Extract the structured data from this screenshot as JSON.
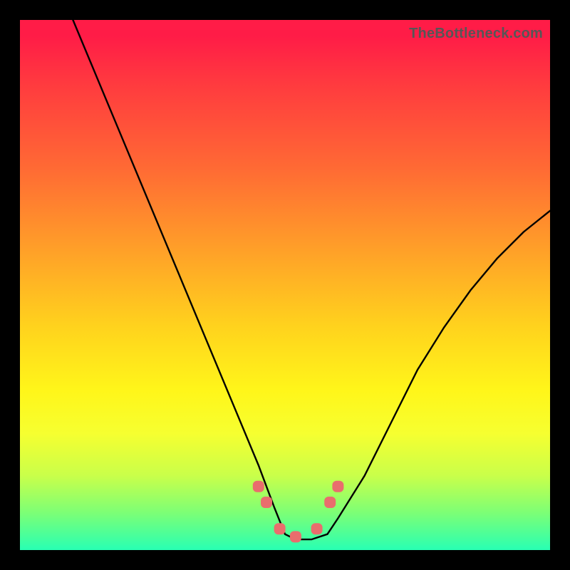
{
  "watermark": "TheBottleneck.com",
  "chart_data": {
    "type": "line",
    "title": "",
    "xlabel": "",
    "ylabel": "",
    "xlim": [
      0,
      100
    ],
    "ylim": [
      0,
      100
    ],
    "grid": false,
    "legend": false,
    "series": [
      {
        "name": "bottleneck-curve",
        "x": [
          10,
          15,
          20,
          25,
          30,
          35,
          40,
          45,
          48,
          50,
          52,
          55,
          58,
          60,
          65,
          70,
          75,
          80,
          85,
          90,
          95,
          100
        ],
        "y": [
          100,
          88,
          76,
          64,
          52,
          40,
          28,
          16,
          8,
          3,
          2,
          2,
          3,
          6,
          14,
          24,
          34,
          42,
          49,
          55,
          60,
          64
        ]
      }
    ],
    "markers": {
      "name": "highlight-points",
      "x": [
        45,
        46.5,
        49,
        52,
        56,
        58.5,
        60
      ],
      "y": [
        12,
        9,
        4,
        2.5,
        4,
        9,
        12
      ]
    },
    "background_gradient": {
      "top": "#ff1c47",
      "mid": "#ffd31d",
      "bottom": "#28ffb3"
    }
  }
}
